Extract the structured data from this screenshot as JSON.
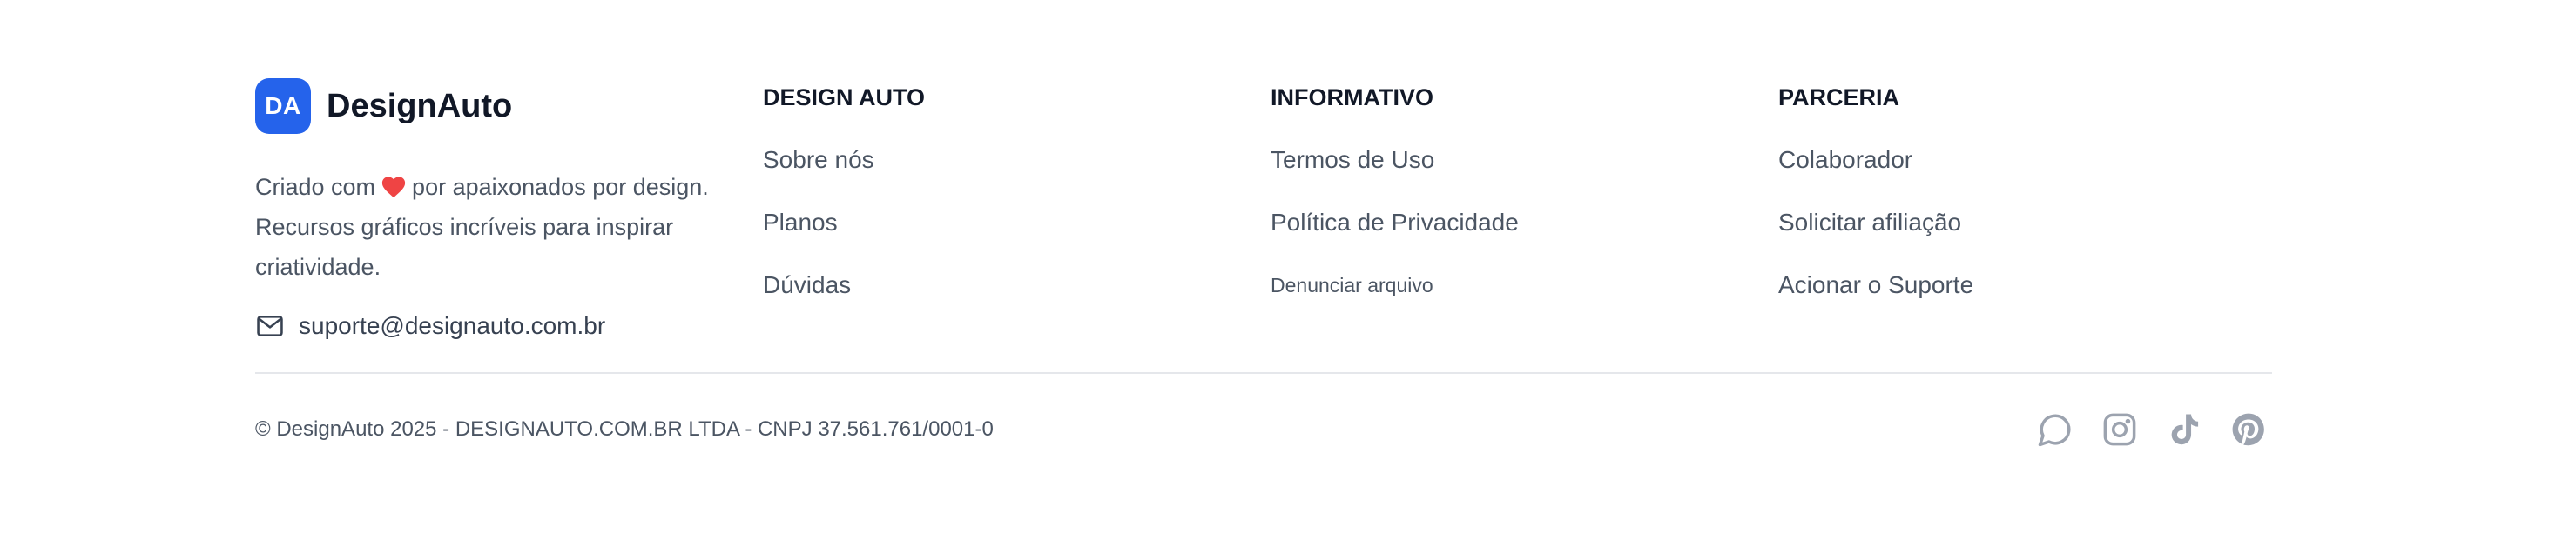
{
  "brand": {
    "logo_initials": "DA",
    "name": "DesignAuto",
    "tagline_before": "Criado com",
    "tagline_after": "por apaixonados por design. Recursos gráficos incríveis para inspirar criatividade.",
    "email": "suporte@designauto.com.br",
    "accent_color": "#2563eb",
    "heart_color": "#ef4444"
  },
  "columns": [
    {
      "heading": "DESIGN AUTO",
      "links": [
        {
          "label": "Sobre nós"
        },
        {
          "label": "Planos"
        },
        {
          "label": "Dúvidas"
        }
      ]
    },
    {
      "heading": "INFORMATIVO",
      "links": [
        {
          "label": "Termos de Uso"
        },
        {
          "label": "Política de Privacidade"
        },
        {
          "label": "Denunciar arquivo"
        }
      ]
    },
    {
      "heading": "PARCERIA",
      "links": [
        {
          "label": "Colaborador"
        },
        {
          "label": "Solicitar afiliação"
        },
        {
          "label": "Acionar o Suporte"
        }
      ]
    }
  ],
  "bottom": {
    "copyright": "© DesignAuto 2025 - DESIGNAUTO.COM.BR LTDA - CNPJ 37.561.761/0001-0",
    "social_icons": [
      "chat-icon",
      "instagram-icon",
      "tiktok-icon",
      "pinterest-icon"
    ],
    "icon_color": "#9ca3af"
  }
}
